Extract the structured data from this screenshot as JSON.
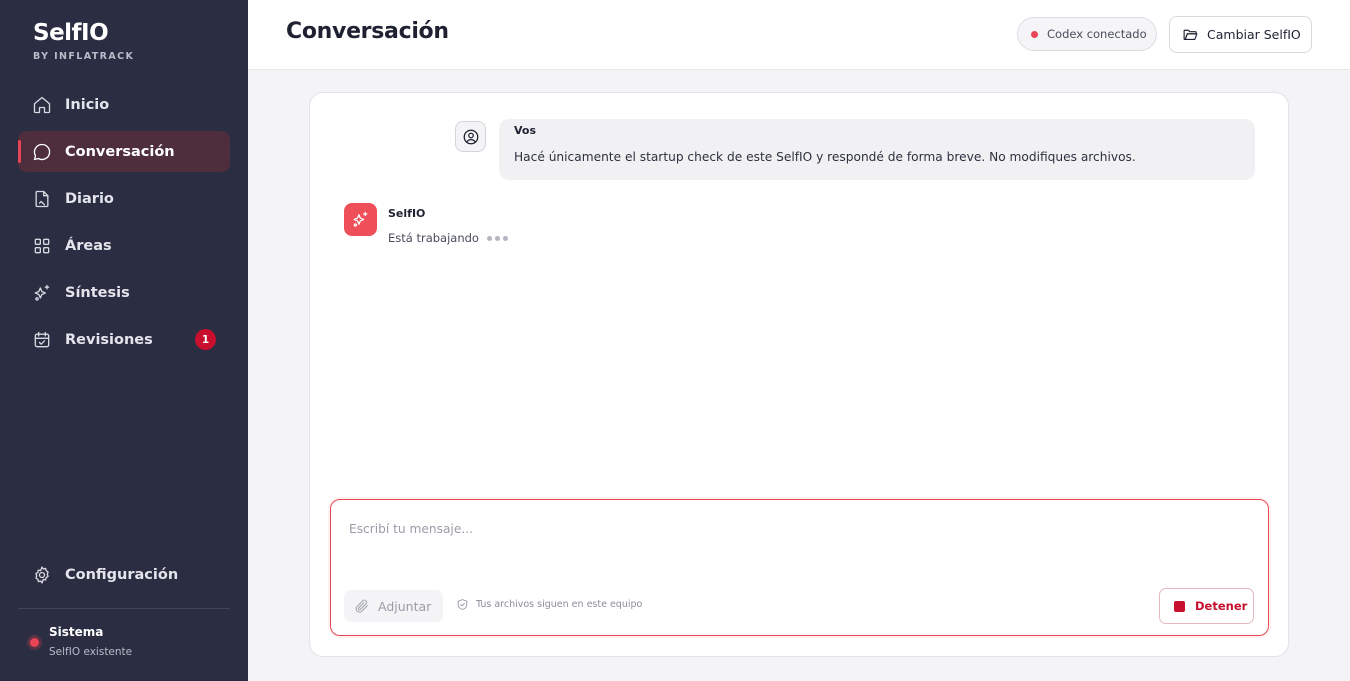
{
  "brand": {
    "name": "SelfIO",
    "sub": "BY INFLATRACK"
  },
  "nav": {
    "items": [
      {
        "label": "Inicio"
      },
      {
        "label": "Conversación"
      },
      {
        "label": "Diario"
      },
      {
        "label": "Áreas"
      },
      {
        "label": "Síntesis"
      },
      {
        "label": "Revisiones",
        "badge": "1"
      }
    ],
    "settings_label": "Configuración"
  },
  "system": {
    "title": "Sistema",
    "subtitle": "SelfIO existente"
  },
  "header": {
    "title": "Conversación",
    "status_label": "Codex conectado",
    "change_button": "Cambiar SelfIO"
  },
  "messages": {
    "user": {
      "author": "Vos",
      "text": "Hacé únicamente el startup check de este SelfIO y respondé de forma breve. No modifiques archivos."
    },
    "assistant": {
      "author": "SelfIO",
      "status": "Está trabajando"
    }
  },
  "composer": {
    "placeholder": "Escribí tu mensaje...",
    "value": "",
    "attach_label": "Adjuntar",
    "local_note": "Tus archivos siguen en este equipo",
    "stop_label": "Detener"
  },
  "colors": {
    "sidebar_bg": "#2b2d42",
    "accent": "#e84455",
    "danger": "#c8102e",
    "bot_avatar": "#ef4f58"
  }
}
